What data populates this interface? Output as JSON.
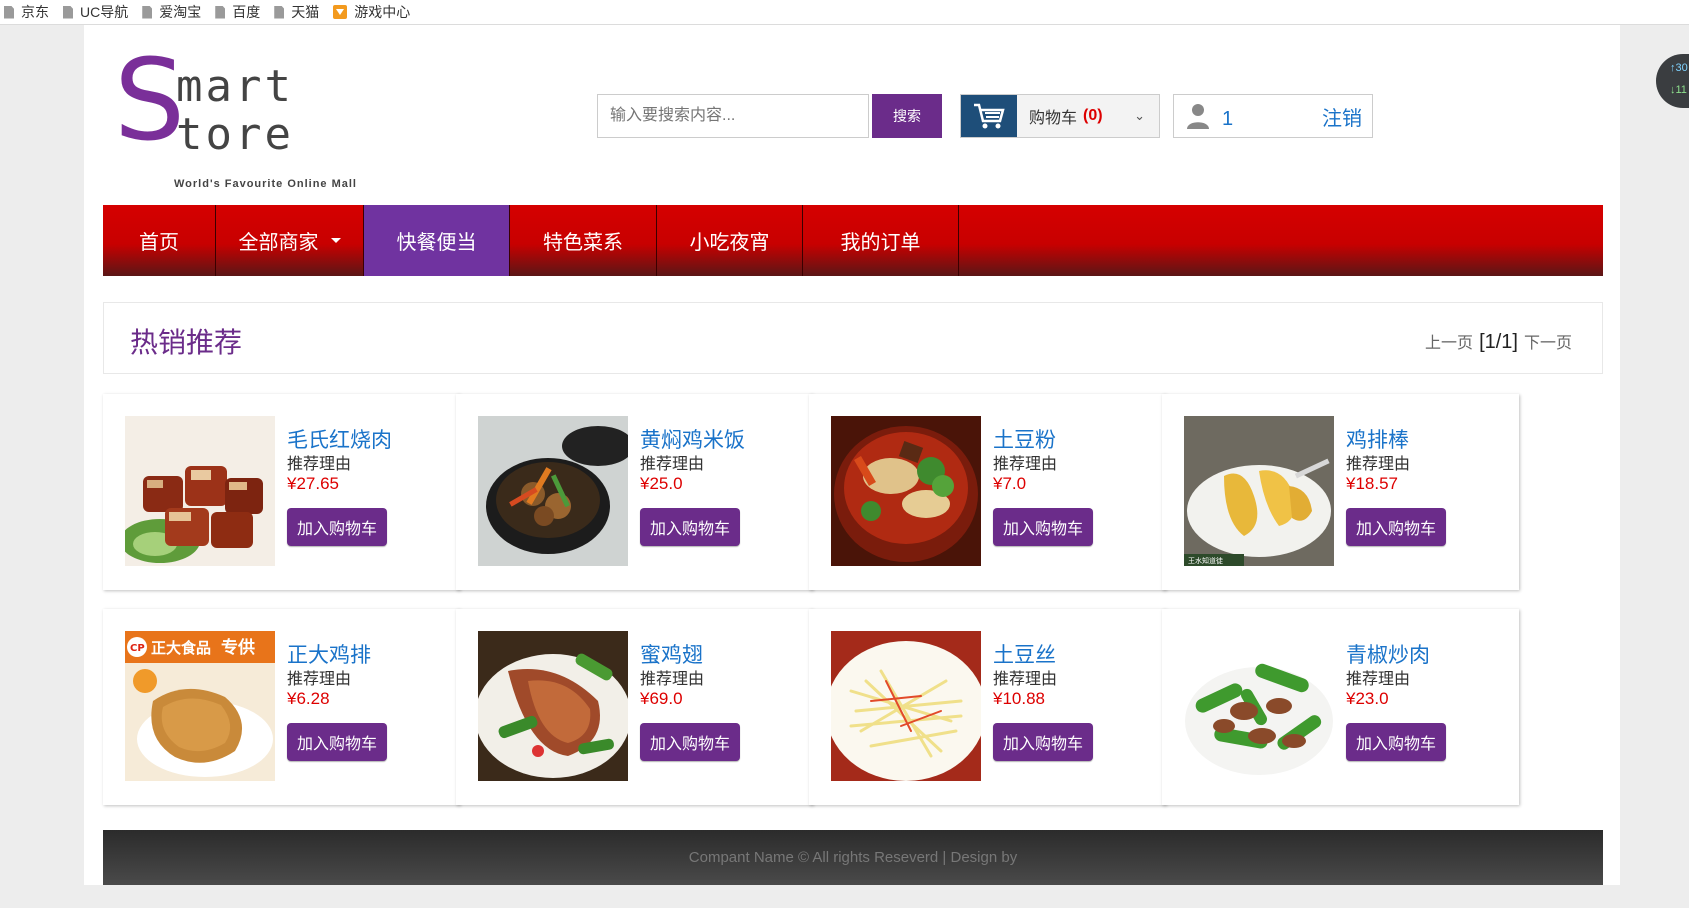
{
  "bookmarks": [
    "京东",
    "UC导航",
    "爱淘宝",
    "百度",
    "天猫",
    "游戏中心"
  ],
  "side_widget": {
    "up": "30",
    "down": "11"
  },
  "logo": {
    "s": "S",
    "line1": "mart",
    "line2": "tore",
    "tagline": "World's Favourite Online Mall"
  },
  "search": {
    "placeholder": "输入要搜索内容...",
    "button": "搜索"
  },
  "cart": {
    "label": "购物车",
    "count": "(0)"
  },
  "user": {
    "id": "1",
    "logout": "注销"
  },
  "nav": [
    "首页",
    "全部商家",
    "快餐便当",
    "特色菜系",
    "小吃夜宵",
    "我的订单"
  ],
  "section": {
    "title": "热销推荐",
    "prev": "上一页",
    "page": "[1/1]",
    "next": "下一页"
  },
  "products": [
    {
      "name": "毛氏红烧肉",
      "reason": "推荐理由",
      "price": "¥27.65",
      "button": "加入购物车"
    },
    {
      "name": "黄焖鸡米饭",
      "reason": "推荐理由",
      "price": "¥25.0",
      "button": "加入购物车"
    },
    {
      "name": "土豆粉",
      "reason": "推荐理由",
      "price": "¥7.0",
      "button": "加入购物车"
    },
    {
      "name": "鸡排棒",
      "reason": "推荐理由",
      "price": "¥18.57",
      "button": "加入购物车"
    },
    {
      "name": "正大鸡排",
      "reason": "推荐理由",
      "price": "¥6.28",
      "button": "加入购物车"
    },
    {
      "name": "蜜鸡翅",
      "reason": "推荐理由",
      "price": "¥69.0",
      "button": "加入购物车"
    },
    {
      "name": "土豆丝",
      "reason": "推荐理由",
      "price": "¥10.88",
      "button": "加入购物车"
    },
    {
      "name": "青椒炒肉",
      "reason": "推荐理由",
      "price": "¥23.0",
      "button": "加入购物车"
    }
  ],
  "image_text": {
    "banner_brand": "正大食品",
    "banner_tag": "专供",
    "cp": "CP",
    "watermark": "王水知道徒"
  },
  "footer": "Compant Name © All rights Reseverd | Design by"
}
